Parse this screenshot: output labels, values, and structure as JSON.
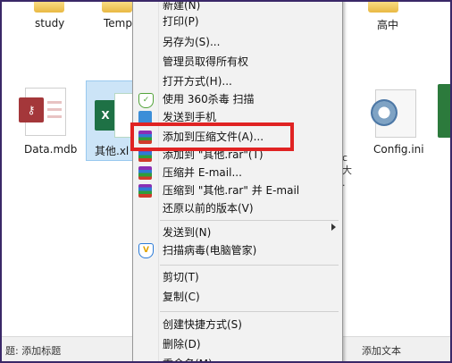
{
  "desktop": {
    "folders": [
      {
        "label": "study"
      },
      {
        "label": "Temp"
      },
      {
        "label": "高中"
      }
    ],
    "files": [
      {
        "label": "Data.mdb"
      },
      {
        "label": "其他.xl"
      },
      {
        "label": "Config.ini"
      }
    ]
  },
  "status": {
    "left": "题: 添加标题",
    "right": "添加文本"
  },
  "menu": {
    "items": [
      {
        "label": "新建(N)"
      },
      {
        "label": "打印(P)"
      },
      {
        "label": "另存为(S)..."
      },
      {
        "label": "管理员取得所有权"
      },
      {
        "label": "打开方式(H)..."
      },
      {
        "label": "使用 360杀毒 扫描"
      },
      {
        "label": "发送到手机"
      },
      {
        "label": "添加到压缩文件(A)..."
      },
      {
        "label": "添加到 \"其他.rar\"(T)"
      },
      {
        "label": "压缩并 E-mail..."
      },
      {
        "label": "压缩到 \"其他.rar\" 并 E-mail"
      },
      {
        "label": "还原以前的版本(V)"
      },
      {
        "label": "发送到(N)"
      },
      {
        "label": "扫描病毒(电脑管家)"
      },
      {
        "label": "剪切(T)"
      },
      {
        "label": "复制(C)"
      },
      {
        "label": "创建快捷方式(S)"
      },
      {
        "label": "删除(D)"
      },
      {
        "label": "重命名(M)"
      }
    ]
  },
  "colors": {
    "frame": "#3a2868",
    "highlight": "#e02323",
    "selection": "#cce4f7"
  }
}
